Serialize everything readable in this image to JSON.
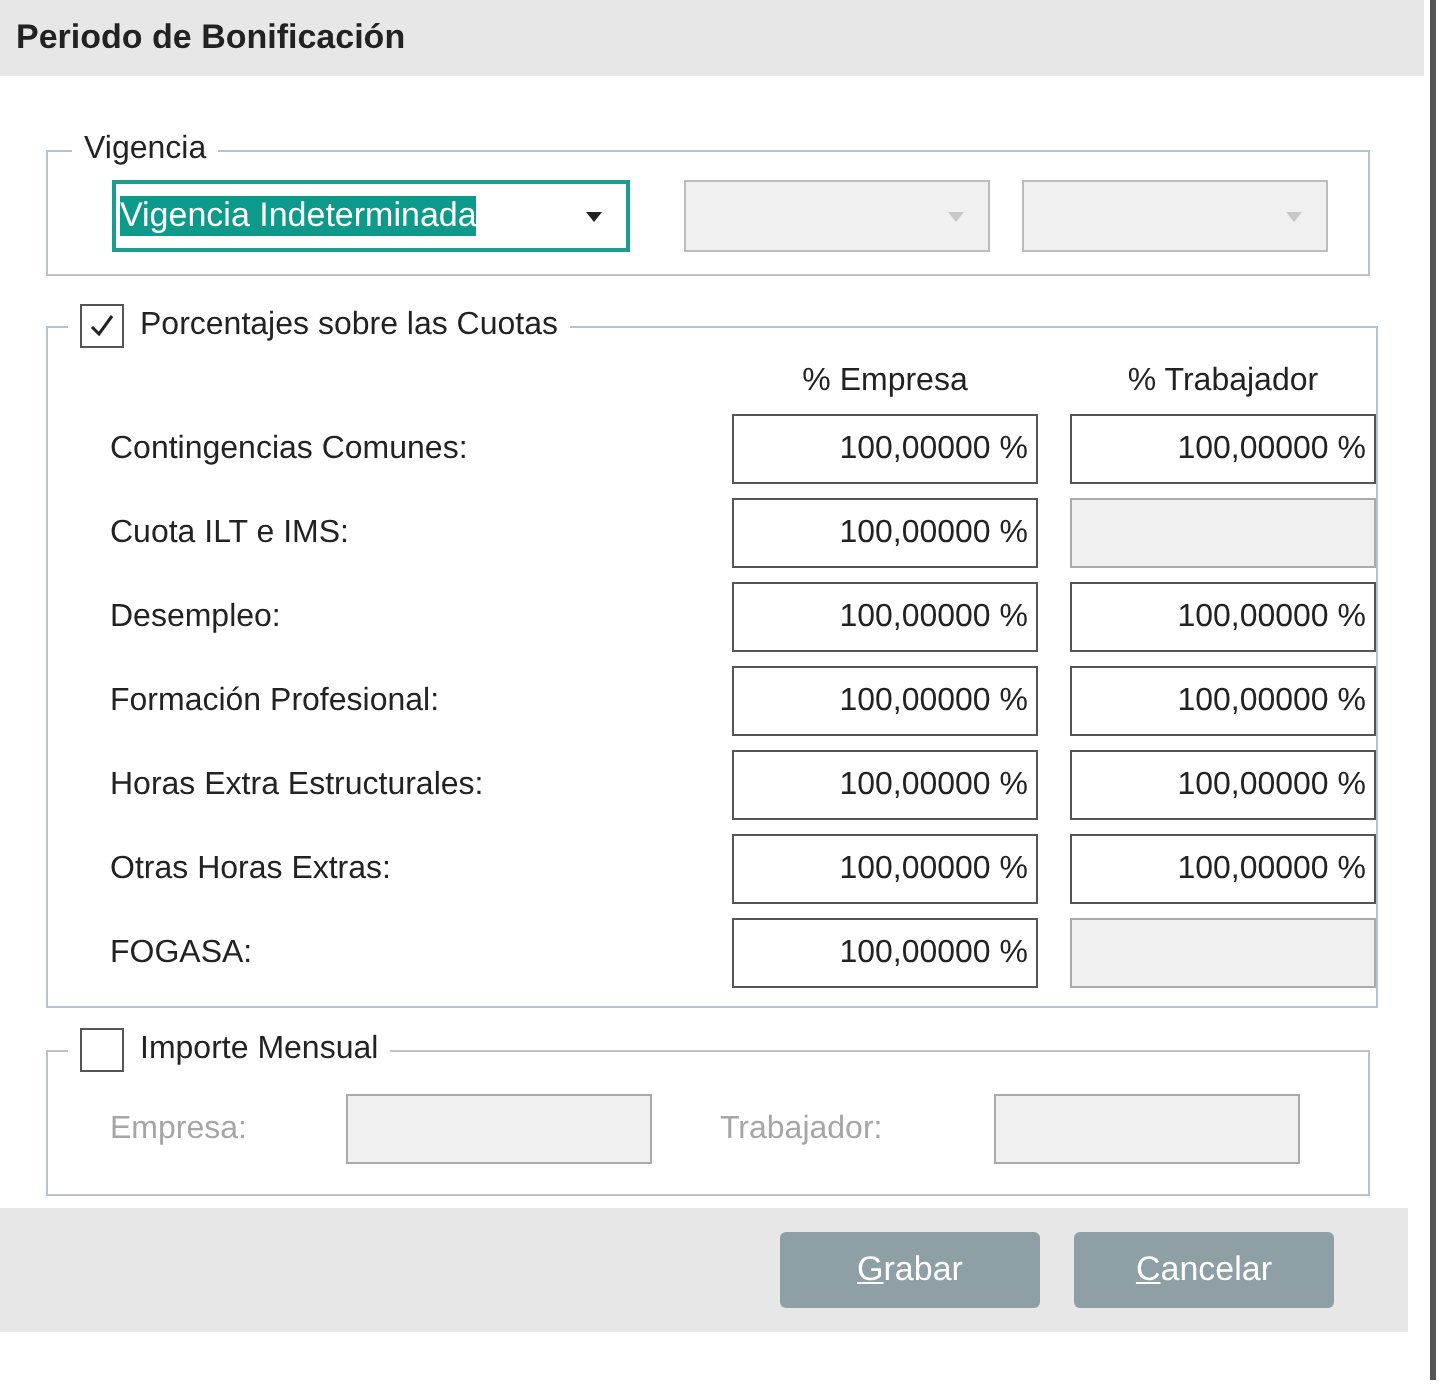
{
  "window": {
    "title": "Periodo de Bonificación"
  },
  "vigencia": {
    "legend": "Vigencia",
    "combos": [
      {
        "value": "Vigencia Indeterminada",
        "disabled": false,
        "focused": true
      },
      {
        "disabled": true,
        "focused": false
      },
      {
        "disabled": true,
        "focused": false
      }
    ]
  },
  "porcentajes": {
    "legend": "Porcentajes sobre las Cuotas",
    "checked": true,
    "columns": [
      "% Empresa",
      "% Trabajador"
    ],
    "rows": [
      {
        "label": "Contingencias Comunes:",
        "empresa": {
          "value": "100,00000 %",
          "disabled": false
        },
        "trabajador": {
          "value": "100,00000 %",
          "disabled": false
        }
      },
      {
        "label": "Cuota ILT e IMS:",
        "empresa": {
          "value": "100,00000 %",
          "disabled": false
        },
        "trabajador": {
          "disabled": true
        }
      },
      {
        "label": "Desempleo:",
        "empresa": {
          "value": "100,00000 %",
          "disabled": false
        },
        "trabajador": {
          "value": "100,00000 %",
          "disabled": false
        }
      },
      {
        "label": "Formación Profesional:",
        "empresa": {
          "value": "100,00000 %",
          "disabled": false
        },
        "trabajador": {
          "value": "100,00000 %",
          "disabled": false
        }
      },
      {
        "label": "Horas Extra Estructurales:",
        "empresa": {
          "value": "100,00000 %",
          "disabled": false
        },
        "trabajador": {
          "value": "100,00000 %",
          "disabled": false
        }
      },
      {
        "label": "Otras Horas Extras:",
        "empresa": {
          "value": "100,00000 %",
          "disabled": false
        },
        "trabajador": {
          "value": "100,00000 %",
          "disabled": false
        }
      },
      {
        "label": "FOGASA:",
        "empresa": {
          "value": "100,00000 %",
          "disabled": false
        },
        "trabajador": {
          "disabled": true
        }
      }
    ]
  },
  "importe": {
    "legend": "Importe Mensual",
    "checked": false,
    "fields": [
      {
        "label": "Empresa:",
        "disabled": true
      },
      {
        "label": "Trabajador:",
        "disabled": true
      }
    ]
  },
  "buttons": [
    {
      "key": "G",
      "rest": "rabar"
    },
    {
      "key": "C",
      "rest": "ancelar"
    }
  ]
}
